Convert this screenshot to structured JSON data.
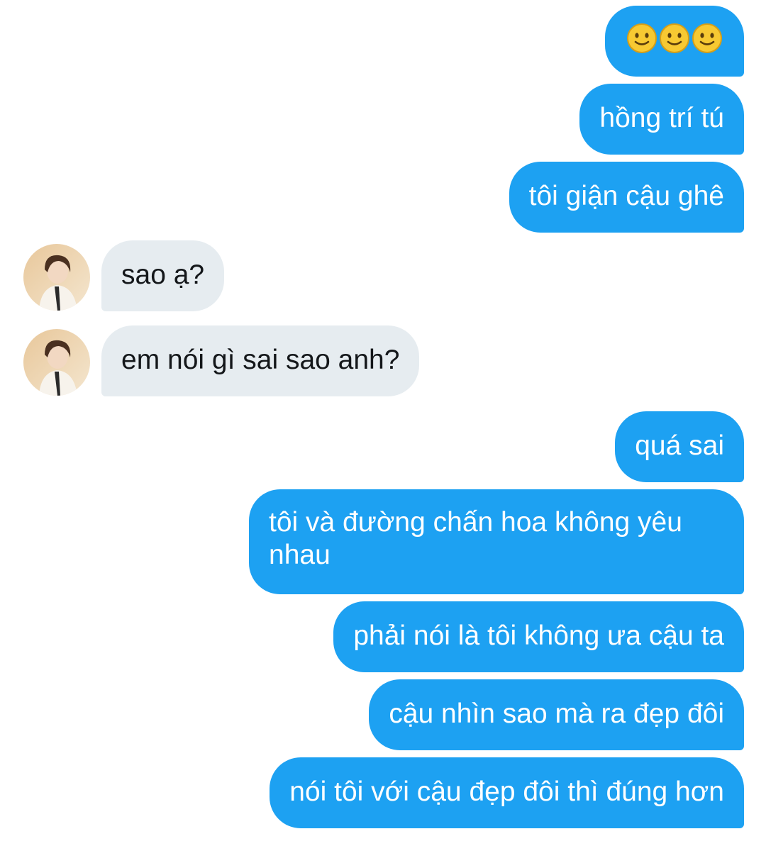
{
  "messages": [
    {
      "id": "m1",
      "direction": "outgoing",
      "icon": "slightly-smiling-face-icon",
      "emoji_count": 3
    },
    {
      "id": "m2",
      "direction": "outgoing",
      "text": "hồng trí tú"
    },
    {
      "id": "m3",
      "direction": "outgoing",
      "text": "tôi giận cậu ghê"
    },
    {
      "id": "m4",
      "direction": "incoming",
      "text": "sao ạ?"
    },
    {
      "id": "m5",
      "direction": "incoming",
      "text": "em nói gì sai sao anh?"
    },
    {
      "id": "m6",
      "direction": "outgoing",
      "text": "quá sai"
    },
    {
      "id": "m7",
      "direction": "outgoing",
      "text": "tôi và đường chấn hoa không yêu nhau"
    },
    {
      "id": "m8",
      "direction": "outgoing",
      "text": "phải nói là tôi không ưa cậu ta"
    },
    {
      "id": "m9",
      "direction": "outgoing",
      "text": "cậu nhìn sao mà ra đẹp đôi"
    },
    {
      "id": "m10",
      "direction": "outgoing",
      "text": "nói tôi với cậu đẹp đôi thì đúng hơn"
    }
  ],
  "colors": {
    "outgoing_bubble": "#1da1f2",
    "outgoing_text": "#ffffff",
    "incoming_bubble": "#e6ecf0",
    "incoming_text": "#14171a",
    "background": "#ffffff"
  }
}
